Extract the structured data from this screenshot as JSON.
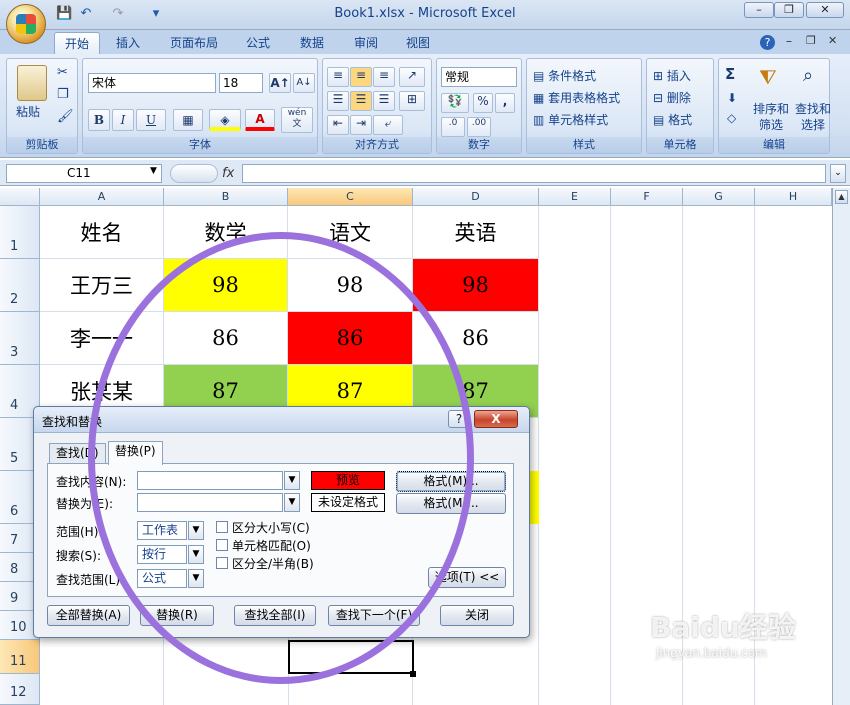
{
  "window": {
    "title": "Book1.xlsx - Microsoft Excel"
  },
  "quick_access": {
    "save": "💾",
    "undo": "↶",
    "redo": "↷",
    "more": "▾"
  },
  "window_controls": {
    "minimize": "–",
    "restore": "❐",
    "close": "✕"
  },
  "ribbon_tabs": [
    "开始",
    "插入",
    "页面布局",
    "公式",
    "数据",
    "审阅",
    "视图"
  ],
  "ribbon_right": {
    "help": "?",
    "min": "–",
    "restore": "❐",
    "close": "✕"
  },
  "ribbon": {
    "clipboard": {
      "label": "剪贴板",
      "paste": "粘贴"
    },
    "font": {
      "label": "字体",
      "name": "宋体",
      "size": "18",
      "grow": "A↑",
      "shrink": "A↓",
      "bold": "B",
      "italic": "I",
      "underline": "U",
      "wen": "wén\n文"
    },
    "alignment": {
      "label": "对齐方式"
    },
    "number": {
      "label": "数字",
      "format": "常规",
      "percent": "%",
      "comma": ","
    },
    "styles": {
      "label": "样式",
      "conditional": "条件格式",
      "table": "套用表格格式",
      "cell": "单元格样式"
    },
    "cells": {
      "label": "单元格",
      "insert": "插入",
      "delete": "删除",
      "format": "格式"
    },
    "editing": {
      "label": "编辑",
      "sigma": "Σ",
      "sort": "排序和\n筛选",
      "find": "查找和\n选择"
    }
  },
  "formula_bar": {
    "name_box": "C11",
    "fx": "fx",
    "value": ""
  },
  "columns": [
    "A",
    "B",
    "C",
    "D",
    "E",
    "F",
    "G",
    "H"
  ],
  "rows": [
    "1",
    "2",
    "3",
    "4",
    "5",
    "6",
    "7",
    "8",
    "9",
    "10",
    "11",
    "12"
  ],
  "selected": {
    "column": "C",
    "row": "11"
  },
  "cells": {
    "A1": "姓名",
    "B1": "数学",
    "C1": "语文",
    "D1": "英语",
    "A2": "王万三",
    "B2": "98",
    "C2": "98",
    "D2": "98",
    "A3": "李一一",
    "B3": "86",
    "C3": "86",
    "D3": "86",
    "A4": "张某某",
    "B4": "87",
    "C4": "87",
    "D4": "87"
  },
  "cell_colors": {
    "yellow": "#ffff00",
    "red": "#ff0000",
    "green": "#92d050"
  },
  "dialog": {
    "title": "查找和替换",
    "help": "?",
    "close": "X",
    "tabs": [
      "查找(D)",
      "替换(P)"
    ],
    "find_label": "查找内容(N):",
    "find_value": "",
    "replace_label": "替换为(E):",
    "replace_value": "",
    "preview": "预览",
    "not_set": "未设定格式",
    "format1": "格式(M)...",
    "format2": "格式(M)...",
    "within_label": "范围(H):",
    "within_value": "工作表",
    "search_label": "搜索(S):",
    "search_value": "按行",
    "lookin_label": "查找范围(L):",
    "lookin_value": "公式",
    "match_case": "区分大小写(C)",
    "match_cell": "单元格匹配(O)",
    "match_byte": "区分全/半角(B)",
    "options": "选项(T) <<",
    "replace_all": "全部替换(A)",
    "replace": "替换(R)",
    "find_all": "查找全部(I)",
    "find_next": "查找下一个(F)",
    "close_btn": "关闭"
  },
  "watermark": {
    "brand": "Baidu经验",
    "url": "jingyan.baidu.com"
  }
}
